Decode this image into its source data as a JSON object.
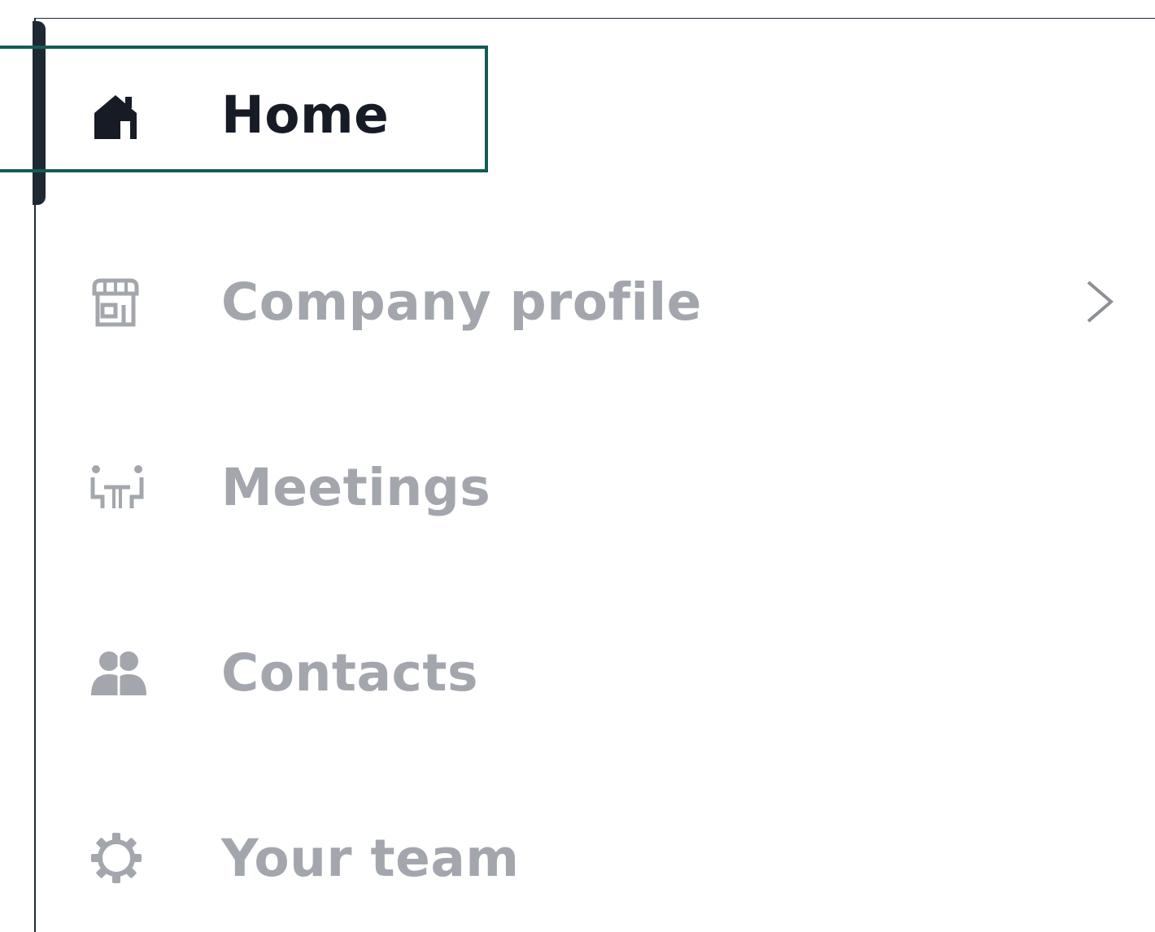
{
  "sidebar": {
    "items": [
      {
        "label": "Home",
        "icon": "home-icon",
        "active": true,
        "has_submenu": false
      },
      {
        "label": "Company profile",
        "icon": "storefront-icon",
        "active": false,
        "has_submenu": true
      },
      {
        "label": "Meetings",
        "icon": "meeting-table-icon",
        "active": false,
        "has_submenu": false
      },
      {
        "label": "Contacts",
        "icon": "contacts-icon",
        "active": false,
        "has_submenu": false
      },
      {
        "label": "Your team",
        "icon": "gear-icon",
        "active": false,
        "has_submenu": false
      }
    ],
    "chevron_icon": "chevron-right-icon"
  },
  "colors": {
    "active_text": "#161b26",
    "inactive_text": "#a3a7ad",
    "highlight_border": "#165b55",
    "indicator": "#1f2933"
  }
}
